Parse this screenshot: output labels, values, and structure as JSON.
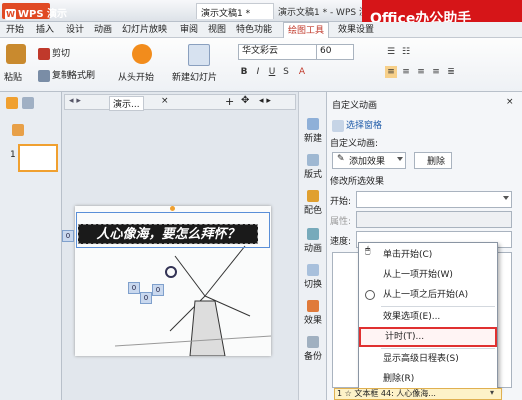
{
  "app": {
    "logo_text": "WPS 演示",
    "doc_tab": "演示文稿1 *",
    "window_title": "演示文稿1 * - WPS 演示",
    "watermark": "Office办公助手"
  },
  "menu": [
    "开始",
    "插入",
    "设计",
    "动画",
    "幻灯片放映",
    "审阅",
    "视图",
    "特色功能",
    "绘图工具",
    "效果设置"
  ],
  "ribbon": {
    "paste": "粘贴",
    "cut": "剪切",
    "copy": "复制",
    "format_painter": "格式刷",
    "play_from_start": "从头开始",
    "new_slide": "新建幻灯片",
    "font_name": "华文彩云",
    "font_size": "60"
  },
  "slide_tabs": {
    "label": "演示..."
  },
  "slide": {
    "title_text": "人心像海，要怎么拜怀？",
    "thumb_number": "1",
    "tags": [
      "0",
      "0",
      "0",
      "0"
    ]
  },
  "vertical_tabs": [
    "新建",
    "版式",
    "配色",
    "动画",
    "切换",
    "效果",
    "备份"
  ],
  "task_pane": {
    "header": "自定义动画",
    "select_window": "选择窗格",
    "section_custom": "自定义动画:",
    "add_effect": "添加效果",
    "remove": "删除",
    "section_modify": "修改所选效果",
    "start_label": "开始:",
    "property_label": "属性:",
    "speed_label": "速度:"
  },
  "context_menu": {
    "items": [
      {
        "label": "单击开始(C)",
        "icon": "mouse-icon"
      },
      {
        "label": "从上一项开始(W)",
        "icon": ""
      },
      {
        "label": "从上一项之后开始(A)",
        "icon": "clock-icon"
      },
      {
        "label": "效果选项(E)...",
        "icon": ""
      },
      {
        "label": "计时(T)...",
        "icon": ""
      },
      {
        "label": "显示高级日程表(S)",
        "icon": ""
      },
      {
        "label": "删除(R)",
        "icon": ""
      }
    ],
    "highlighted_index": 4
  },
  "anim_list_item": "1  ☆  文本框 44: 人心像海...",
  "colors": {
    "accent": "#e03030",
    "wps_orange": "#e04a24"
  }
}
